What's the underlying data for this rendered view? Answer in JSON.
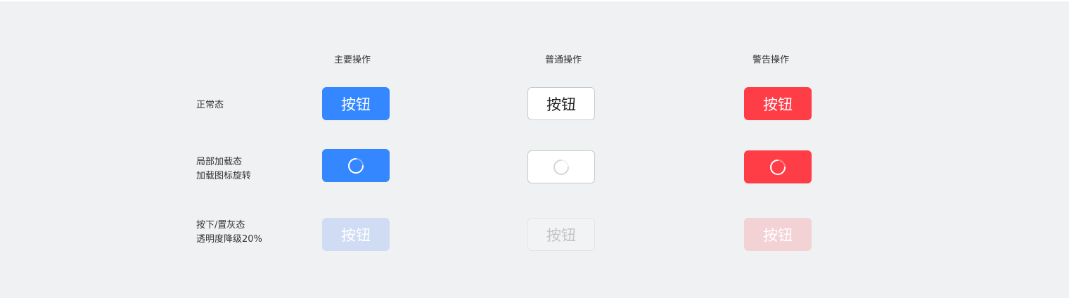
{
  "columns": {
    "primary": "主要操作",
    "normal": "普通操作",
    "warning": "警告操作"
  },
  "rows": {
    "normal_state": {
      "label": "正常态"
    },
    "loading_state": {
      "line1": "局部加载态",
      "line2": "加载图标旋转"
    },
    "disabled_state": {
      "line1": "按下/置灰态",
      "line2": "透明度降级20%"
    }
  },
  "button_label": "按钮",
  "colors": {
    "primary": "#3487ff",
    "warning": "#ff3d46",
    "normal_border": "#c9c9c9",
    "background": "#f0f1f3"
  },
  "icons": {
    "loading": "loading-spinner-icon"
  }
}
